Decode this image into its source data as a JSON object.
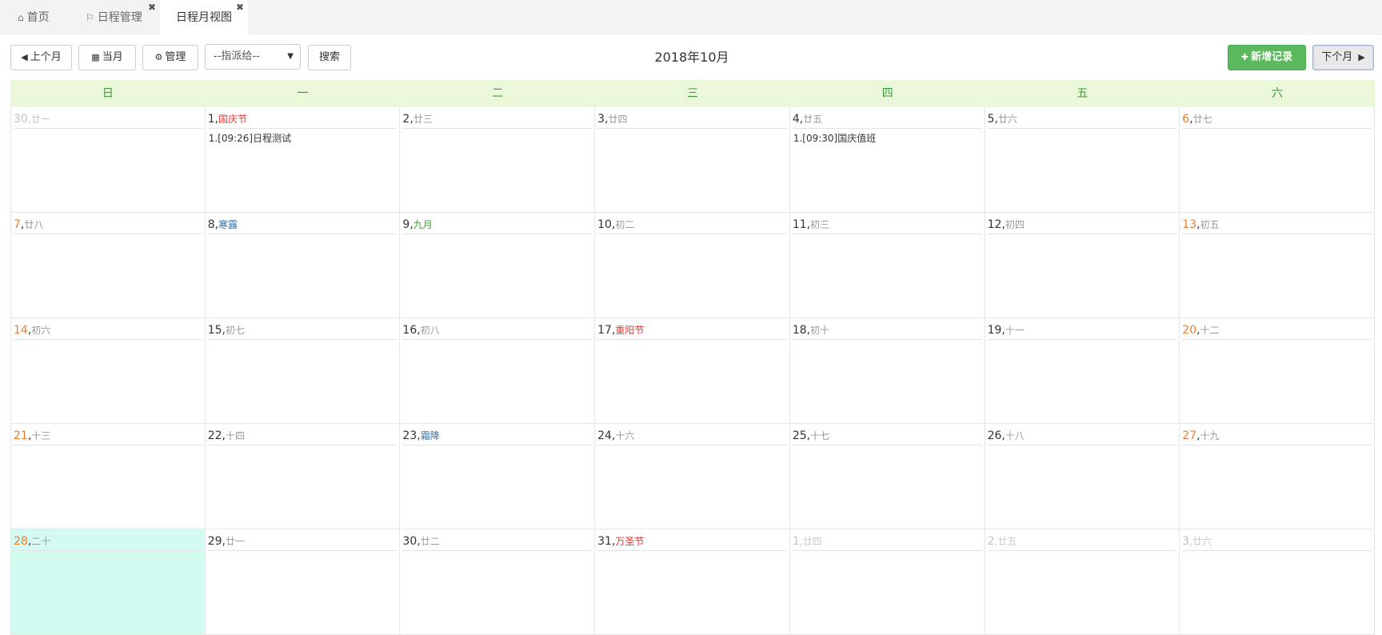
{
  "tabs": [
    {
      "label": "首页",
      "icon": "home-icon",
      "glyph": "⌂",
      "closable": false,
      "active": false
    },
    {
      "label": "日程管理",
      "icon": "bookmark-icon",
      "glyph": "⚐",
      "closable": true,
      "active": false
    },
    {
      "label": "日程月视图",
      "icon": "",
      "glyph": "",
      "closable": true,
      "active": true
    }
  ],
  "close_glyph": "✖",
  "toolbar": {
    "prev_label": "上个月",
    "prev_glyph": "◀",
    "current_label": "当月",
    "current_glyph": "▦",
    "manage_label": "管理",
    "manage_glyph": "⚙",
    "assign_value": "--指派给--",
    "assign_caret": "▼",
    "search_label": "搜索",
    "add_label": "新增记录",
    "add_glyph": "✚",
    "next_label": "下个月",
    "next_glyph": "▶"
  },
  "month_title": "2018年10月",
  "weekdays": [
    "日",
    "一",
    "二",
    "三",
    "四",
    "五",
    "六"
  ],
  "colors": {
    "weekend": "#f07d2a",
    "festival": "#e33333",
    "solar_term": "#2a6fb0",
    "lunar_month": "#36a336",
    "header_bg": "#eaf7d9",
    "today_bg": "#d4fbf2",
    "add_button": "#5cb85c"
  },
  "weeks": [
    [
      {
        "day": "30",
        "lunar": "廿一",
        "type": "other"
      },
      {
        "day": "1",
        "lunar": "国庆节",
        "type": "fest",
        "events": [
          "1.[09:26]日程测试"
        ]
      },
      {
        "day": "2",
        "lunar": "廿三"
      },
      {
        "day": "3",
        "lunar": "廿四"
      },
      {
        "day": "4",
        "lunar": "廿五",
        "events": [
          "1.[09:30]国庆值班"
        ]
      },
      {
        "day": "5",
        "lunar": "廿六"
      },
      {
        "day": "6",
        "lunar": "廿七",
        "weekend": true
      }
    ],
    [
      {
        "day": "7",
        "lunar": "廿八",
        "weekend": true
      },
      {
        "day": "8",
        "lunar": "寒露",
        "type": "term"
      },
      {
        "day": "9",
        "lunar": "九月",
        "type": "month"
      },
      {
        "day": "10",
        "lunar": "初二"
      },
      {
        "day": "11",
        "lunar": "初三"
      },
      {
        "day": "12",
        "lunar": "初四"
      },
      {
        "day": "13",
        "lunar": "初五",
        "weekend": true
      }
    ],
    [
      {
        "day": "14",
        "lunar": "初六",
        "weekend": true
      },
      {
        "day": "15",
        "lunar": "初七"
      },
      {
        "day": "16",
        "lunar": "初八"
      },
      {
        "day": "17",
        "lunar": "重阳节",
        "type": "fest"
      },
      {
        "day": "18",
        "lunar": "初十"
      },
      {
        "day": "19",
        "lunar": "十一"
      },
      {
        "day": "20",
        "lunar": "十二",
        "weekend": true
      }
    ],
    [
      {
        "day": "21",
        "lunar": "十三",
        "weekend": true
      },
      {
        "day": "22",
        "lunar": "十四"
      },
      {
        "day": "23",
        "lunar": "霜降",
        "type": "term"
      },
      {
        "day": "24",
        "lunar": "十六"
      },
      {
        "day": "25",
        "lunar": "十七"
      },
      {
        "day": "26",
        "lunar": "十八"
      },
      {
        "day": "27",
        "lunar": "十九",
        "weekend": true
      }
    ],
    [
      {
        "day": "28",
        "lunar": "二十",
        "weekend": true,
        "today": true
      },
      {
        "day": "29",
        "lunar": "廿一"
      },
      {
        "day": "30",
        "lunar": "廿二"
      },
      {
        "day": "31",
        "lunar": "万圣节",
        "type": "fest"
      },
      {
        "day": "1",
        "lunar": "廿四",
        "type": "other"
      },
      {
        "day": "2",
        "lunar": "廿五",
        "type": "other"
      },
      {
        "day": "3",
        "lunar": "廿六",
        "type": "other"
      }
    ]
  ]
}
